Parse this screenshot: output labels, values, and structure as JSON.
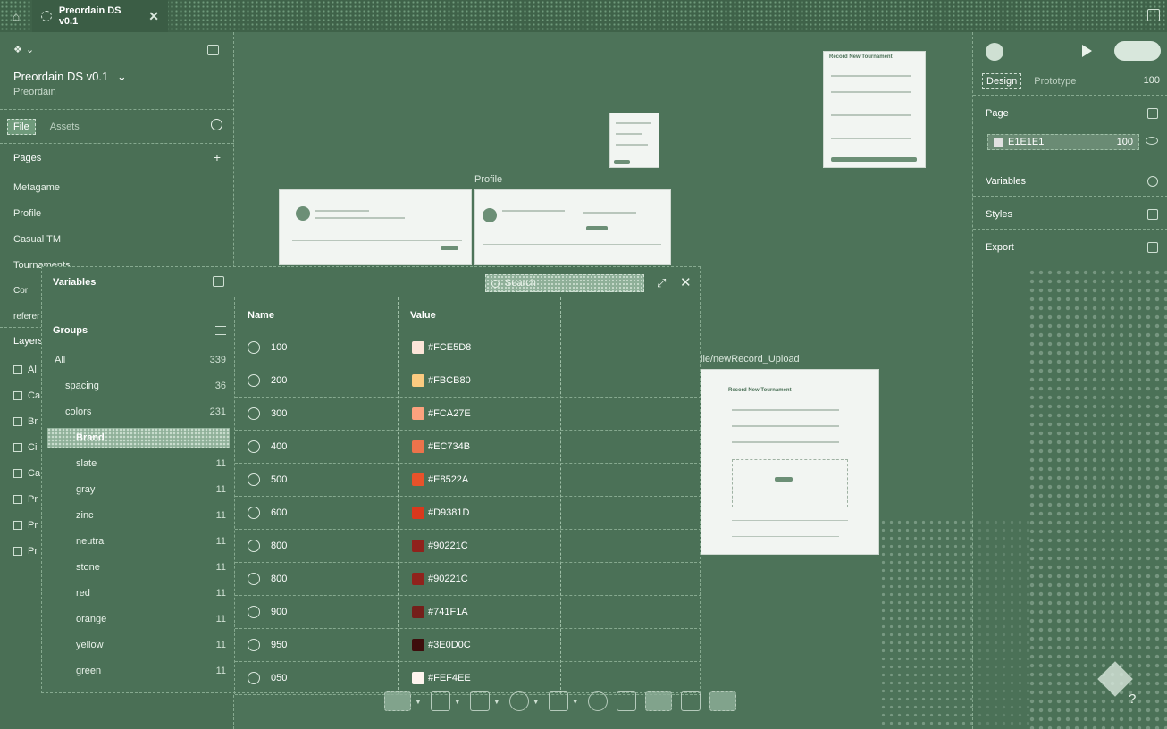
{
  "tab": {
    "title": "Preordain DS v0.1"
  },
  "left": {
    "file_name": "Preordain DS v0.1",
    "file_chevron": "⌄",
    "project": "Preordain",
    "tabs": {
      "file": "File",
      "assets": "Assets"
    },
    "pages_title": "Pages",
    "pages": [
      "Metagame",
      "Profile",
      "Casual TM",
      "Tournaments",
      "Cor",
      "referer"
    ],
    "layers_title": "Layers",
    "layers": [
      "Al",
      "Ca",
      "Br",
      "Ci",
      "Ca",
      "Pr",
      "Pr",
      "Pr"
    ]
  },
  "right": {
    "tabs": {
      "design": "Design",
      "prototype": "Prototype"
    },
    "zoom": "100",
    "page_label": "Page",
    "page_color": {
      "hex": "E1E1E1",
      "opacity": "100"
    },
    "variables_label": "Variables",
    "styles_label": "Styles",
    "export_label": "Export"
  },
  "canvas": {
    "profile_label": "Profile",
    "upload_label": "ile/newRecord_Upload",
    "record_title": "Record New Tournament",
    "top_frame_title": "Record New Tournament"
  },
  "variables": {
    "title": "Variables",
    "search_placeholder": "Search",
    "groups_title": "Groups",
    "groups": [
      {
        "name": "All",
        "count": "339",
        "indent": 0,
        "selected": false
      },
      {
        "name": "spacing",
        "count": "36",
        "indent": 1,
        "selected": false
      },
      {
        "name": "colors",
        "count": "231",
        "indent": 1,
        "selected": false
      },
      {
        "name": "Brand",
        "count": "",
        "indent": 2,
        "selected": true
      },
      {
        "name": "slate",
        "count": "11",
        "indent": 2,
        "selected": false
      },
      {
        "name": "gray",
        "count": "11",
        "indent": 2,
        "selected": false
      },
      {
        "name": "zinc",
        "count": "11",
        "indent": 2,
        "selected": false
      },
      {
        "name": "neutral",
        "count": "11",
        "indent": 2,
        "selected": false
      },
      {
        "name": "stone",
        "count": "11",
        "indent": 2,
        "selected": false
      },
      {
        "name": "red",
        "count": "11",
        "indent": 2,
        "selected": false
      },
      {
        "name": "orange",
        "count": "11",
        "indent": 2,
        "selected": false
      },
      {
        "name": "yellow",
        "count": "11",
        "indent": 2,
        "selected": false
      },
      {
        "name": "green",
        "count": "11",
        "indent": 2,
        "selected": false
      }
    ],
    "columns": {
      "name": "Name",
      "value": "Value"
    },
    "rows": [
      {
        "name": "100",
        "value": "#FCE5D8",
        "color": "#FCE5D8"
      },
      {
        "name": "200",
        "value": "#FBCB80",
        "color": "#FBCB80"
      },
      {
        "name": "300",
        "value": "#FCA27E",
        "color": "#FCA27E"
      },
      {
        "name": "400",
        "value": "#EC734B",
        "color": "#EC734B"
      },
      {
        "name": "500",
        "value": "#E8522A",
        "color": "#E8522A"
      },
      {
        "name": "600",
        "value": "#D9381D",
        "color": "#D9381D"
      },
      {
        "name": "800",
        "value": "#90221C",
        "color": "#90221C"
      },
      {
        "name": "800",
        "value": "#90221C",
        "color": "#90221C"
      },
      {
        "name": "900",
        "value": "#741F1A",
        "color": "#741F1A"
      },
      {
        "name": "950",
        "value": "#3E0D0C",
        "color": "#3E0D0C"
      },
      {
        "name": "050",
        "value": "#FEF4EE",
        "color": "#FEF4EE"
      }
    ]
  },
  "colors": {
    "canvas": "#4d7359",
    "panel": "#4a6f55",
    "accent": "#8fb099"
  }
}
